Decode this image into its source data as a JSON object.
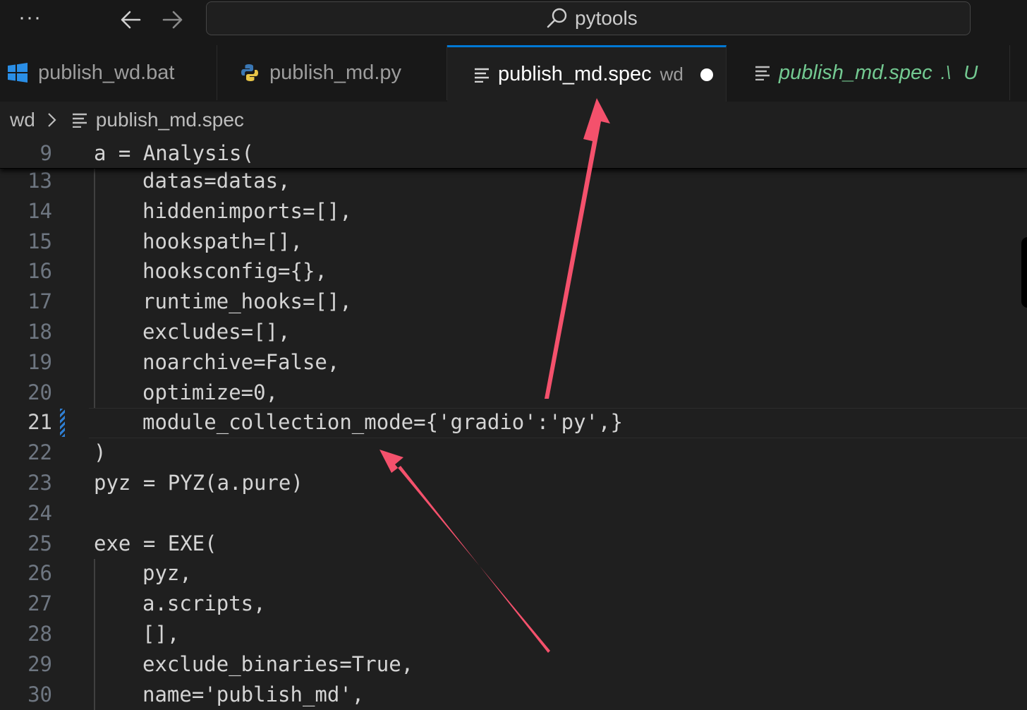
{
  "titlebar": {
    "more_label": "···",
    "search_text": "pytools"
  },
  "tabs": [
    {
      "label": "publish_wd.bat",
      "icon": "windows-icon"
    },
    {
      "label": "publish_md.py",
      "icon": "python-icon"
    },
    {
      "label": "publish_md.spec",
      "description": "wd",
      "icon": "lines-icon",
      "active": true,
      "modified": true
    },
    {
      "label": "publish_md.spec",
      "description": ".\\",
      "status": "U",
      "icon": "lines-icon",
      "untracked": true
    }
  ],
  "breadcrumb": {
    "folder": "wd",
    "file": "publish_md.spec"
  },
  "editor": {
    "sticky": {
      "number": "9",
      "text": "a = Analysis("
    },
    "current_line": "21",
    "lines": [
      {
        "number": "13",
        "text": "datas=datas,"
      },
      {
        "number": "14",
        "text": "hiddenimports=[],"
      },
      {
        "number": "15",
        "text": "hookspath=[],"
      },
      {
        "number": "16",
        "text": "hooksconfig={},"
      },
      {
        "number": "17",
        "text": "runtime_hooks=[],"
      },
      {
        "number": "18",
        "text": "excludes=[],"
      },
      {
        "number": "19",
        "text": "noarchive=False,"
      },
      {
        "number": "20",
        "text": "optimize=0,"
      },
      {
        "number": "21",
        "text": "module_collection_mode={'gradio':'py',}"
      },
      {
        "number": "22",
        "text": ")"
      },
      {
        "number": "23",
        "text": "pyz = PYZ(a.pure)"
      },
      {
        "number": "24",
        "text": ""
      },
      {
        "number": "25",
        "text": "exe = EXE("
      },
      {
        "number": "26",
        "text": "pyz,"
      },
      {
        "number": "27",
        "text": "a.scripts,"
      },
      {
        "number": "28",
        "text": "[],"
      },
      {
        "number": "29",
        "text": "exclude_binaries=True,"
      },
      {
        "number": "30",
        "text": "name='publish_md',"
      }
    ]
  },
  "colors": {
    "background": "#1f1f1f",
    "tab_active_border": "#0078d4",
    "untracked": "#73c991",
    "annotation_arrow": "#f4516c"
  }
}
